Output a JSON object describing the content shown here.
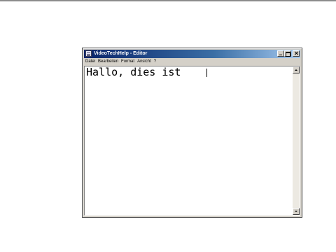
{
  "window": {
    "title": "VideoTechHelp - Editor"
  },
  "menu": {
    "items": [
      "Datei",
      "Bearbeiten",
      "Format",
      "Ansicht",
      "?"
    ]
  },
  "editor": {
    "content": "Hallo, dies ist "
  },
  "colors": {
    "titlebar_start": "#0a246a",
    "titlebar_end": "#a6caf0",
    "window_face": "#d4d0c8"
  },
  "icons": {
    "app": "notepad-icon",
    "minimize": "minimize-icon",
    "maximize": "maximize-icon",
    "close": "close-icon",
    "scroll_up": "arrow-up-icon",
    "scroll_down": "arrow-down-icon"
  }
}
